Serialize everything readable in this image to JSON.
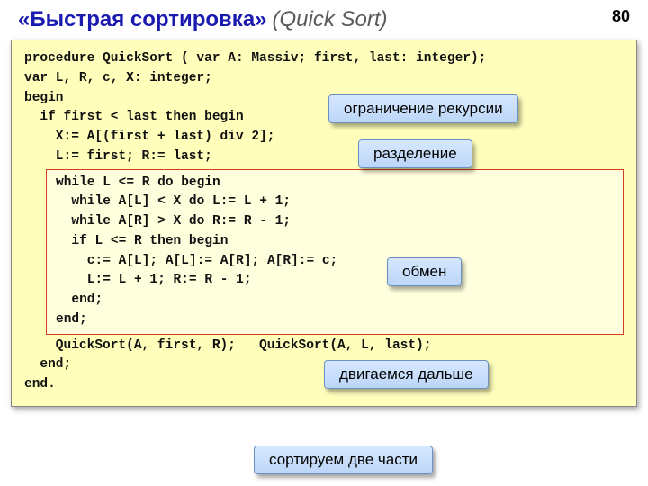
{
  "page_number": "80",
  "title": {
    "main": "«Быстрая сортировка»",
    "sub": "(Quick Sort)"
  },
  "code": {
    "l1": "procedure QuickSort ( var A: Massiv; first, last: integer);",
    "l2": "var L, R, c, X: integer;",
    "l3": "begin",
    "l4": "  if first < last then begin",
    "l5": "    X:= A[(first + last) div 2];",
    "l6": "    L:= first; R:= last;",
    "inner": {
      "l1": "while L <= R do begin",
      "l2": "  while A[L] < X do L:= L + 1;",
      "l3": "  while A[R] > X do R:= R - 1;",
      "l4": "  if L <= R then begin",
      "l5": "    c:= A[L]; A[L]:= A[R]; A[R]:= c;",
      "l6": "    L:= L + 1; R:= R - 1;",
      "l7": "  end;",
      "l8": "end;"
    },
    "l7": "    QuickSort(A, first, R);   QuickSort(A, L, last);",
    "l8": "  end;",
    "l9": "end."
  },
  "callouts": {
    "recursion_limit": "ограничение рекурсии",
    "partition": "разделение",
    "swap": "обмен",
    "move_on": "двигаемся дальше",
    "sort_two": "сортируем две части"
  }
}
